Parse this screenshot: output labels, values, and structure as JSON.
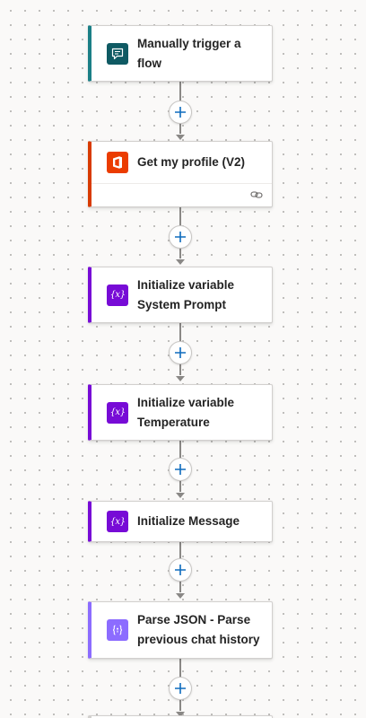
{
  "flow": {
    "steps": [
      {
        "title": "Manually trigger a flow",
        "icon": "chat-trigger-icon",
        "accent": "#1b7f86",
        "icon_bg": "#0f5a63"
      },
      {
        "title": "Get my profile (V2)",
        "icon": "office-icon",
        "accent": "#d83b01",
        "icon_bg": "#eb3c00"
      },
      {
        "title": "Initialize variable System Prompt",
        "icon": "variable-icon",
        "accent": "#770bd6",
        "icon_bg": "#770bd6"
      },
      {
        "title": "Initialize variable Temperature",
        "icon": "variable-icon",
        "accent": "#770bd6",
        "icon_bg": "#770bd6"
      },
      {
        "title": "Initialize Message",
        "icon": "variable-icon",
        "accent": "#770bd6",
        "icon_bg": "#770bd6"
      },
      {
        "title": "Parse JSON - Parse previous chat history",
        "icon": "parse-json-icon",
        "accent": "#8c6cff",
        "icon_bg": "#8c6cff"
      }
    ],
    "variable_glyph": "{x}",
    "parse_glyph": "{}",
    "add_icon": "plus-icon",
    "footer_icon": "link-icon"
  }
}
